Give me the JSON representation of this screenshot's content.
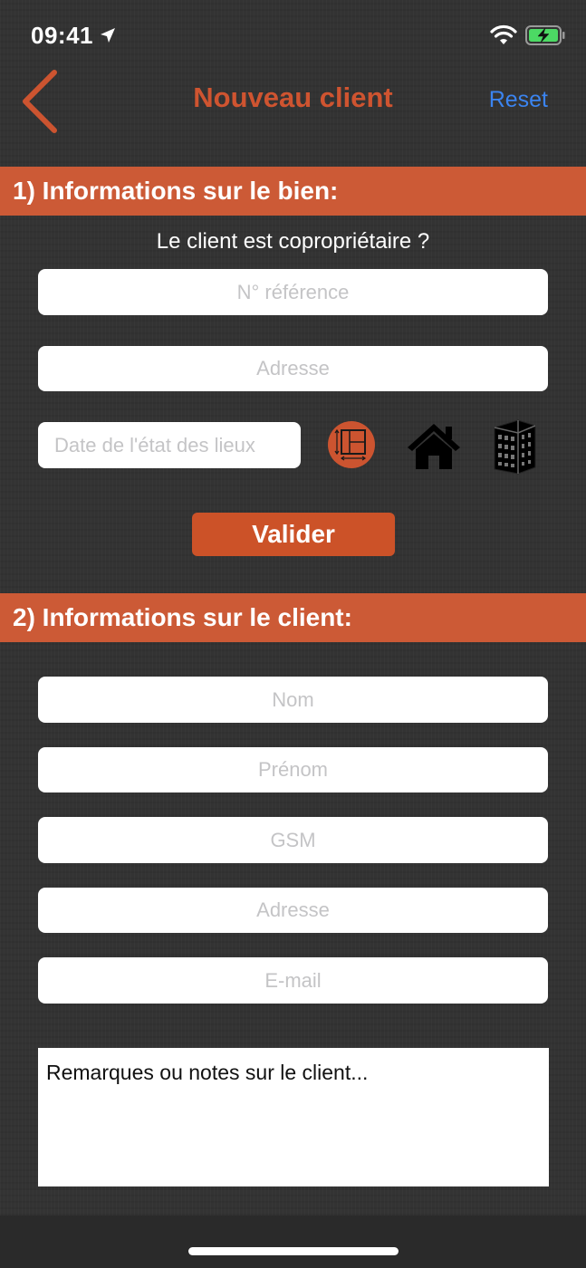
{
  "status_bar": {
    "time": "09:41"
  },
  "nav": {
    "title": "Nouveau client",
    "reset_label": "Reset"
  },
  "section1": {
    "header": "1) Informations sur le bien:",
    "question": "Le client est copropriétaire ?",
    "reference_placeholder": "N° référence",
    "address_placeholder": "Adresse",
    "date_placeholder": "Date de l'état des lieux",
    "validate_label": "Valider",
    "property_types": [
      "floor-plan-icon",
      "house-icon",
      "building-icon"
    ],
    "selected_type": "floor-plan-icon"
  },
  "section2": {
    "header": "2) Informations sur le client:",
    "name_placeholder": "Nom",
    "firstname_placeholder": "Prénom",
    "gsm_placeholder": "GSM",
    "address_placeholder": "Adresse",
    "email_placeholder": "E-mail",
    "notes_placeholder": "Remarques ou notes sur le client..."
  },
  "colors": {
    "accent": "#cc5a36",
    "button": "#cc5228",
    "reset": "#3b84f0",
    "background": "#333333"
  }
}
